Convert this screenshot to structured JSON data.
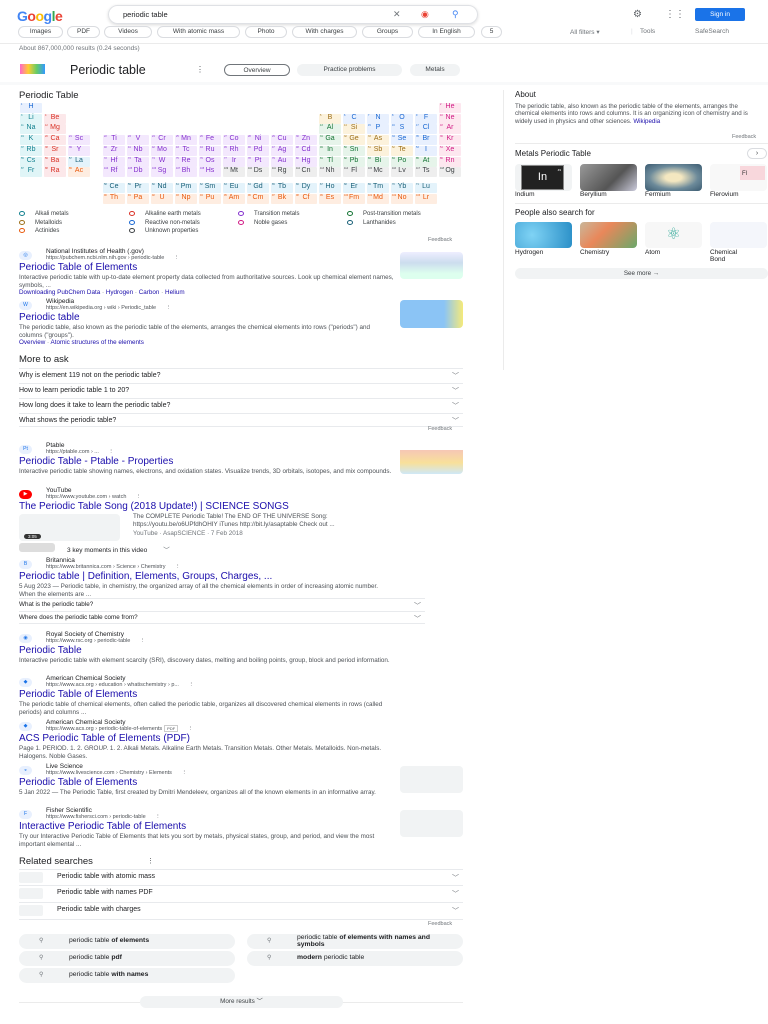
{
  "header": {
    "logo": "Google",
    "query": "periodic table",
    "sign_in": "Sign in",
    "chips": [
      "Images",
      "PDF",
      "Videos",
      "With atomic mass",
      "Photo",
      "With charges",
      "Groups",
      "In English",
      "5"
    ],
    "all_filters": "All filters",
    "tools": "Tools",
    "safesearch": "SafeSearch"
  },
  "result_stats": "About 867,000,000 results (0.24 seconds)",
  "kp": {
    "title": "Periodic table",
    "tabs": [
      "Overview",
      "Practice problems",
      "Metals"
    ]
  },
  "periodic": {
    "heading": "Periodic Table",
    "elements": [
      [
        1,
        "H",
        "nm",
        1,
        1
      ],
      [
        2,
        "He",
        "ng",
        1,
        18
      ],
      [
        3,
        "Li",
        "al",
        2,
        1
      ],
      [
        4,
        "Be",
        "ae",
        2,
        2
      ],
      [
        5,
        "B",
        "md",
        2,
        13
      ],
      [
        6,
        "C",
        "nm",
        2,
        14
      ],
      [
        7,
        "N",
        "nm",
        2,
        15
      ],
      [
        8,
        "O",
        "nm",
        2,
        16
      ],
      [
        9,
        "F",
        "nm",
        2,
        17
      ],
      [
        10,
        "Ne",
        "ng",
        2,
        18
      ],
      [
        11,
        "Na",
        "al",
        3,
        1
      ],
      [
        12,
        "Mg",
        "ae",
        3,
        2
      ],
      [
        13,
        "Al",
        "pt",
        3,
        13
      ],
      [
        14,
        "Si",
        "md",
        3,
        14
      ],
      [
        15,
        "P",
        "nm",
        3,
        15
      ],
      [
        16,
        "S",
        "nm",
        3,
        16
      ],
      [
        17,
        "Cl",
        "nm",
        3,
        17
      ],
      [
        18,
        "Ar",
        "ng",
        3,
        18
      ],
      [
        19,
        "K",
        "al",
        4,
        1
      ],
      [
        20,
        "Ca",
        "ae",
        4,
        2
      ],
      [
        21,
        "Sc",
        "tm",
        4,
        3
      ],
      [
        22,
        "Ti",
        "tm",
        4,
        4
      ],
      [
        23,
        "V",
        "tm",
        4,
        5
      ],
      [
        24,
        "Cr",
        "tm",
        4,
        6
      ],
      [
        25,
        "Mn",
        "tm",
        4,
        7
      ],
      [
        26,
        "Fe",
        "tm",
        4,
        8
      ],
      [
        27,
        "Co",
        "tm",
        4,
        9
      ],
      [
        28,
        "Ni",
        "tm",
        4,
        10
      ],
      [
        29,
        "Cu",
        "tm",
        4,
        11
      ],
      [
        30,
        "Zn",
        "tm",
        4,
        12
      ],
      [
        31,
        "Ga",
        "pt",
        4,
        13
      ],
      [
        32,
        "Ge",
        "md",
        4,
        14
      ],
      [
        33,
        "As",
        "md",
        4,
        15
      ],
      [
        34,
        "Se",
        "nm",
        4,
        16
      ],
      [
        35,
        "Br",
        "nm",
        4,
        17
      ],
      [
        36,
        "Kr",
        "ng",
        4,
        18
      ],
      [
        37,
        "Rb",
        "al",
        5,
        1
      ],
      [
        38,
        "Sr",
        "ae",
        5,
        2
      ],
      [
        39,
        "Y",
        "tm",
        5,
        3
      ],
      [
        40,
        "Zr",
        "tm",
        5,
        4
      ],
      [
        41,
        "Nb",
        "tm",
        5,
        5
      ],
      [
        42,
        "Mo",
        "tm",
        5,
        6
      ],
      [
        43,
        "Tc",
        "tm",
        5,
        7
      ],
      [
        44,
        "Ru",
        "tm",
        5,
        8
      ],
      [
        45,
        "Rh",
        "tm",
        5,
        9
      ],
      [
        46,
        "Pd",
        "tm",
        5,
        10
      ],
      [
        47,
        "Ag",
        "tm",
        5,
        11
      ],
      [
        48,
        "Cd",
        "tm",
        5,
        12
      ],
      [
        49,
        "In",
        "pt",
        5,
        13
      ],
      [
        50,
        "Sn",
        "pt",
        5,
        14
      ],
      [
        51,
        "Sb",
        "md",
        5,
        15
      ],
      [
        52,
        "Te",
        "md",
        5,
        16
      ],
      [
        53,
        "I",
        "nm",
        5,
        17
      ],
      [
        54,
        "Xe",
        "ng",
        5,
        18
      ],
      [
        55,
        "Cs",
        "al",
        6,
        1
      ],
      [
        56,
        "Ba",
        "ae",
        6,
        2
      ],
      [
        57,
        "La",
        "la",
        6,
        3
      ],
      [
        72,
        "Hf",
        "tm",
        6,
        4
      ],
      [
        73,
        "Ta",
        "tm",
        6,
        5
      ],
      [
        74,
        "W",
        "tm",
        6,
        6
      ],
      [
        75,
        "Re",
        "tm",
        6,
        7
      ],
      [
        76,
        "Os",
        "tm",
        6,
        8
      ],
      [
        77,
        "Ir",
        "tm",
        6,
        9
      ],
      [
        78,
        "Pt",
        "tm",
        6,
        10
      ],
      [
        79,
        "Au",
        "tm",
        6,
        11
      ],
      [
        80,
        "Hg",
        "tm",
        6,
        12
      ],
      [
        81,
        "Tl",
        "pt",
        6,
        13
      ],
      [
        82,
        "Pb",
        "pt",
        6,
        14
      ],
      [
        83,
        "Bi",
        "pt",
        6,
        15
      ],
      [
        84,
        "Po",
        "pt",
        6,
        16
      ],
      [
        85,
        "At",
        "pt",
        6,
        17
      ],
      [
        86,
        "Rn",
        "ng",
        6,
        18
      ],
      [
        87,
        "Fr",
        "al",
        7,
        1
      ],
      [
        88,
        "Ra",
        "ae",
        7,
        2
      ],
      [
        89,
        "Ac",
        "ac",
        7,
        3
      ],
      [
        104,
        "Rf",
        "tm",
        7,
        4
      ],
      [
        105,
        "Db",
        "tm",
        7,
        5
      ],
      [
        106,
        "Sg",
        "tm",
        7,
        6
      ],
      [
        107,
        "Bh",
        "tm",
        7,
        7
      ],
      [
        108,
        "Hs",
        "tm",
        7,
        8
      ],
      [
        109,
        "Mt",
        "uk",
        7,
        9
      ],
      [
        110,
        "Ds",
        "uk",
        7,
        10
      ],
      [
        111,
        "Rg",
        "uk",
        7,
        11
      ],
      [
        112,
        "Cn",
        "uk",
        7,
        12
      ],
      [
        113,
        "Nh",
        "uk",
        7,
        13
      ],
      [
        114,
        "Fl",
        "uk",
        7,
        14
      ],
      [
        115,
        "Mc",
        "uk",
        7,
        15
      ],
      [
        116,
        "Lv",
        "uk",
        7,
        16
      ],
      [
        117,
        "Ts",
        "uk",
        7,
        17
      ],
      [
        118,
        "Og",
        "uk",
        7,
        18
      ],
      [
        58,
        "Ce",
        "la",
        9,
        4
      ],
      [
        59,
        "Pr",
        "la",
        9,
        5
      ],
      [
        60,
        "Nd",
        "la",
        9,
        6
      ],
      [
        61,
        "Pm",
        "la",
        9,
        7
      ],
      [
        62,
        "Sm",
        "la",
        9,
        8
      ],
      [
        63,
        "Eu",
        "la",
        9,
        9
      ],
      [
        64,
        "Gd",
        "la",
        9,
        10
      ],
      [
        65,
        "Tb",
        "la",
        9,
        11
      ],
      [
        66,
        "Dy",
        "la",
        9,
        12
      ],
      [
        67,
        "Ho",
        "la",
        9,
        13
      ],
      [
        68,
        "Er",
        "la",
        9,
        14
      ],
      [
        69,
        "Tm",
        "la",
        9,
        15
      ],
      [
        70,
        "Yb",
        "la",
        9,
        16
      ],
      [
        71,
        "Lu",
        "la",
        9,
        17
      ],
      [
        90,
        "Th",
        "ac",
        10,
        4
      ],
      [
        91,
        "Pa",
        "ac",
        10,
        5
      ],
      [
        92,
        "U",
        "ac",
        10,
        6
      ],
      [
        93,
        "Np",
        "ac",
        10,
        7
      ],
      [
        94,
        "Pu",
        "ac",
        10,
        8
      ],
      [
        95,
        "Am",
        "ac",
        10,
        9
      ],
      [
        96,
        "Cm",
        "ac",
        10,
        10
      ],
      [
        97,
        "Bk",
        "ac",
        10,
        11
      ],
      [
        98,
        "Cf",
        "ac",
        10,
        12
      ],
      [
        99,
        "Es",
        "ac",
        10,
        13
      ],
      [
        100,
        "Fm",
        "ac",
        10,
        14
      ],
      [
        101,
        "Md",
        "ac",
        10,
        15
      ],
      [
        102,
        "No",
        "ac",
        10,
        16
      ],
      [
        103,
        "Lr",
        "ac",
        10,
        17
      ]
    ],
    "categories": {
      "al": {
        "label": "Alkali metals",
        "bg": "#e0f5f7",
        "fg": "#12808f"
      },
      "ae": {
        "label": "Alkaline earth metals",
        "bg": "#fce8ea",
        "fg": "#d93025"
      },
      "tm": {
        "label": "Transition metals",
        "bg": "#f3e8fd",
        "fg": "#8430ce"
      },
      "pt": {
        "label": "Post-transition metals",
        "bg": "#e6f4ea",
        "fg": "#137333"
      },
      "md": {
        "label": "Metalloids",
        "bg": "#fcf2dc",
        "fg": "#9c6f19"
      },
      "nm": {
        "label": "Reactive non-metals",
        "bg": "#e8f0fe",
        "fg": "#1967d2"
      },
      "ng": {
        "label": "Noble gases",
        "bg": "#fde7ef",
        "fg": "#d01884"
      },
      "la": {
        "label": "Lanthanides",
        "bg": "#e4f3fb",
        "fg": "#185f77"
      },
      "ac": {
        "label": "Actinides",
        "bg": "#feede1",
        "fg": "#e8590c"
      },
      "uk": {
        "label": "Unknown properties",
        "bg": "#eeeeee",
        "fg": "#3c4043"
      }
    },
    "legend_order": [
      "al",
      "ae",
      "tm",
      "pt",
      "md",
      "nm",
      "ng",
      "la",
      "ac",
      "uk"
    ],
    "feedback": "Feedback"
  },
  "results": [
    {
      "source": "National Institutes of Health (.gov)",
      "url": "https://pubchem.ncbi.nlm.nih.gov › periodic-table",
      "title": "Periodic Table of Elements",
      "snippet": "Interactive periodic table with up-to-date element property data collected from authoritative sources. Look up chemical element names, symbols, ...",
      "links": [
        "Downloading PubChem Data",
        "Hydrogen",
        "Carbon",
        "Helium"
      ],
      "fav": "◎"
    },
    {
      "source": "Wikipedia",
      "url": "https://en.wikipedia.org › wiki › Periodic_table",
      "title": "Periodic table",
      "snippet": "The periodic table, also known as the periodic table of the elements, arranges the chemical elements into rows (\"periods\") and columns (\"groups\").",
      "links": [
        "Overview",
        "Atomic structures of the elements"
      ],
      "fav": "W"
    },
    {
      "source": "Ptable",
      "url": "https://ptable.com › ...",
      "title": "Periodic Table - Ptable - Properties",
      "snippet": "Interactive periodic table showing names, electrons, and oxidation states. Visualize trends, 3D orbitals, isotopes, and mix compounds.",
      "fav": "Pt"
    },
    {
      "source": "YouTube",
      "url": "https://www.youtube.com › watch",
      "title": "The Periodic Table Song (2018 Update!) | SCIENCE SONGS",
      "fav": "▶"
    },
    {
      "source": "Britannica",
      "url": "https://www.britannica.com › Science › Chemistry",
      "title": "Periodic table | Definition, Elements, Groups, Charges, ...",
      "snippet": "5 Aug 2023 — Periodic table, in chemistry, the organized array of all the chemical elements in order of increasing atomic number. When the elements are ...",
      "fav": "B"
    },
    {
      "source": "Royal Society of Chemistry",
      "url": "https://www.rsc.org › periodic-table",
      "title": "Periodic Table",
      "snippet": "Interactive periodic table with element scarcity (SRI), discovery dates, melting and boiling points, group, block and period information.",
      "fav": "◉"
    },
    {
      "source": "American Chemical Society",
      "url": "https://www.acs.org › education › whatischemistry › p...",
      "title": "Periodic Table of Elements",
      "snippet": "The periodic table of chemical elements, often called the periodic table, organizes all discovered chemical elements in rows (called periods) and columns ...",
      "fav": "◆"
    },
    {
      "source": "American Chemical Society",
      "url": "https://www.acs.org › periodic-table-of-elements",
      "url_badge": "PDF",
      "title": "ACS Periodic Table of Elements (PDF)",
      "snippet": "Page 1. PERIOD. 1. 2. GROUP. 1. 2. Alkali Metals. Alkaline Earth Metals. Transition Metals. Other Metals. Metalloids. Non-metals. Halogens. Noble Gases.",
      "fav": "◆"
    },
    {
      "source": "Live Science",
      "url": "https://www.livescience.com › Chemistry › Elements",
      "title": "Periodic Table of Elements",
      "snippet": "5 Jan 2022 — The Periodic Table, first created by Dmitri Mendeleev, organizes all of the known elements in an informative array.",
      "fav": "◒"
    },
    {
      "source": "Fisher Scientific",
      "url": "https://www.fishersci.com › periodic-table",
      "title": "Interactive Periodic Table of Elements",
      "snippet": "Try our Interactive Periodic Table of Elements that lets you sort by metals, physical states, group, and period, and view the most important elemental ...",
      "fav": "F"
    }
  ],
  "youtube": {
    "desc1": "The COMPLETE Periodic Table! The END OF THE UNIVERSE Song:",
    "desc2": "https://youtu.be/o6UPfdhOHIY iTunes http://bit.ly/asaptable Check out ...",
    "meta": "YouTube · AsapSCIENCE · 7 Feb 2018",
    "duration": "3:05",
    "key_moments": "3 key moments in this video"
  },
  "britannica_questions": [
    "What is the periodic table?",
    "Where does the periodic table come from?"
  ],
  "more_to_ask": {
    "heading": "More to ask",
    "questions": [
      "Why is element 119 not on the periodic table?",
      "How to learn periodic table 1 to 20?",
      "How long does it take to learn the periodic table?",
      "What shows the periodic table?"
    ],
    "feedback": "Feedback"
  },
  "related": {
    "heading": "Related searches",
    "items": [
      "Periodic table with atomic mass",
      "Periodic table with names PDF",
      "Periodic table with charges"
    ],
    "feedback": "Feedback",
    "pills": [
      [
        "periodic table ",
        "of elements"
      ],
      [
        "periodic table ",
        "of elements with names and symbols"
      ],
      [
        "periodic table ",
        "pdf"
      ],
      [
        "",
        "modern",
        " periodic table"
      ],
      [
        "periodic table ",
        "with names"
      ]
    ]
  },
  "more_results": "More results",
  "about": {
    "heading": "About",
    "text": "The periodic table, also known as the periodic table of the elements, arranges the chemical elements into rows and columns. It is an organizing icon of chemistry and is widely used in physics and other sciences.",
    "source": "Wikipedia",
    "feedback": "Feedback"
  },
  "metals": {
    "heading": "Metals Periodic Table",
    "items": [
      "Indium",
      "Beryllium",
      "Fermium",
      "Flerovium"
    ],
    "indium_symbol": "In",
    "indium_number": "49",
    "flerovium_symbol": "Fl"
  },
  "people": {
    "heading": "People also search for",
    "items": [
      "Hydrogen",
      "Chemistry",
      "Atom",
      "Chemical Bond"
    ],
    "see_more": "See more"
  }
}
